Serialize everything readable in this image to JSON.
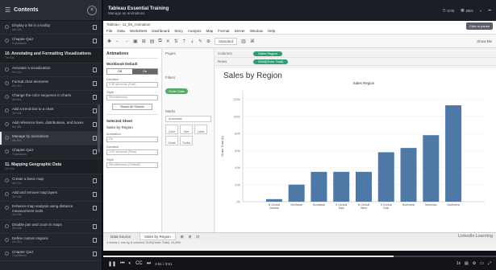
{
  "sidebar": {
    "title": "Contents",
    "items": [
      {
        "type": "item",
        "title": "Display a list in a tooltip",
        "sub": "5m 12s"
      },
      {
        "type": "item",
        "title": "Chapter Quiz",
        "sub": "3 questions"
      },
      {
        "type": "section",
        "title": "10. Annotating and Formatting Visualizations",
        "sub": "7m 36s"
      },
      {
        "type": "item",
        "title": "Annotate a visualization",
        "sub": "5m 12s"
      },
      {
        "type": "item",
        "title": "Format chart elements",
        "sub": "2m 41s"
      },
      {
        "type": "item",
        "title": "Change the color sequence in charts",
        "sub": "3m 51s"
      },
      {
        "type": "item",
        "title": "Add a trend line to a chart",
        "sub": "3m 19s"
      },
      {
        "type": "item",
        "title": "Add reference lines, distributions, and boxes",
        "sub": "5m 48s"
      },
      {
        "type": "item",
        "title": "Manage by animations",
        "sub": "3m 51s",
        "active": true
      },
      {
        "type": "item",
        "title": "Chapter Quiz",
        "sub": "3 questions"
      },
      {
        "type": "section",
        "title": "11. Mapping Geographic Data",
        "sub": "1h 14m"
      },
      {
        "type": "item",
        "title": "Create a basic map",
        "sub": "4m 12s"
      },
      {
        "type": "item",
        "title": "Add and remove map layers",
        "sub": "3m 43s"
      },
      {
        "type": "item",
        "title": "Enhance map analysis using distance measurement tools",
        "sub": "4m 24s"
      },
      {
        "type": "item",
        "title": "Disable pan and zoom in maps",
        "sub": "2m 14s"
      },
      {
        "type": "item",
        "title": "Define custom regions",
        "sub": "5m 51s"
      },
      {
        "type": "item",
        "title": "Chapter Quiz",
        "sub": "3 questions"
      }
    ]
  },
  "topbar": {
    "course": "Tableau Essential Training",
    "lesson": "Manage an animations",
    "ctl1": "0:00",
    "ctl2": "ZEN",
    "ctl3": "+"
  },
  "tableau": {
    "window_title": "Tableau - 11_05_Animation",
    "menu": [
      "File",
      "Data",
      "Worksheet",
      "Dashboard",
      "Story",
      "Analysis",
      "Map",
      "Format",
      "Server",
      "Window",
      "Help"
    ],
    "toolbar_dropdown": "Standard",
    "showme": "Show Me",
    "badge": "Click to pause",
    "panel": {
      "title": "Animations",
      "workbook_default": "Workbook Default",
      "seg_off": "Off",
      "seg_on": "On",
      "duration_label": "Duration",
      "duration_value": "0.30 seconds (Fast)",
      "style_label": "Style",
      "style_value": "Simultaneous",
      "reset_button": "Reset All Sheets",
      "selected_sheet": "Selected Sheet",
      "sheet_name": "Sales by Region",
      "animation_label": "Animation",
      "animation_value": "On",
      "duration2_label": "Duration",
      "duration2_value": "1.00 seconds (Slow)",
      "style2_label": "Style",
      "style2_value": "Simultaneous (Default)"
    },
    "pages": {
      "pages_label": "Pages",
      "filters_label": "Filters",
      "filter_pill": "Order Date",
      "marks_label": "Marks",
      "marks_dropdown": "Automatic",
      "marks_buttons": [
        "Color",
        "Size",
        "Label",
        "Detail",
        "Tooltip"
      ]
    },
    "shelves": {
      "columns_label": "Columns",
      "columns_pill": "Sales Region",
      "rows_label": "Rows",
      "rows_pill": "SUM(Order Total)"
    },
    "chart_title": "Sales by Region",
    "sheet_tabs": [
      "Data Source",
      "Sales by Region"
    ],
    "status": "4 marks   1 row by 8 columns   SUM(Order Total): 44,856",
    "watermark": "LinkedIn Learning"
  },
  "chart_data": {
    "type": "bar",
    "title": "Sales Region",
    "ylabel": "Order Total (k)",
    "ylim": [
      0,
      130
    ],
    "yticks": [
      0,
      20,
      40,
      60,
      80,
      100,
      120
    ],
    "categories": [
      "N Central Canada",
      "Northeast",
      "Southeast",
      "S Central East",
      "N Central West",
      "S Central East",
      "Northwest",
      "Northeast",
      "Southwest"
    ],
    "values": [
      3,
      20,
      35,
      35,
      35,
      58,
      63,
      78,
      113
    ],
    "bar_color": "#4e79a7"
  },
  "player": {
    "time": "2:51 / 3:51",
    "progress": 0.74
  }
}
